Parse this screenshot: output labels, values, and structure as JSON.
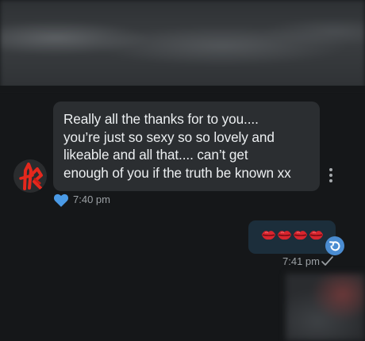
{
  "incoming_message": {
    "lines": [
      "Really all the thanks for to you....",
      "you’re just so sexy so so lovely and",
      "likeable and all that.... can’t get",
      "enough of you if the truth be known xx"
    ],
    "time": "7:40 pm",
    "reaction_icon": "heart-icon",
    "colors": {
      "bubble": "#2b2e31",
      "reaction": "#4a9ae6"
    }
  },
  "outgoing_message": {
    "content_icons": [
      "kiss-lips-icon",
      "kiss-lips-icon",
      "kiss-lips-icon",
      "kiss-lips-icon"
    ],
    "time": "7:41 pm",
    "status_icon": "check-icon",
    "colors": {
      "bubble": "#1c2e3b",
      "reply_badge": "#4a8cd1"
    }
  },
  "colors": {
    "background": "#151719",
    "text": "#eceff1",
    "meta_text": "#9ba0a4",
    "avatar_mark": "#e5281d"
  }
}
